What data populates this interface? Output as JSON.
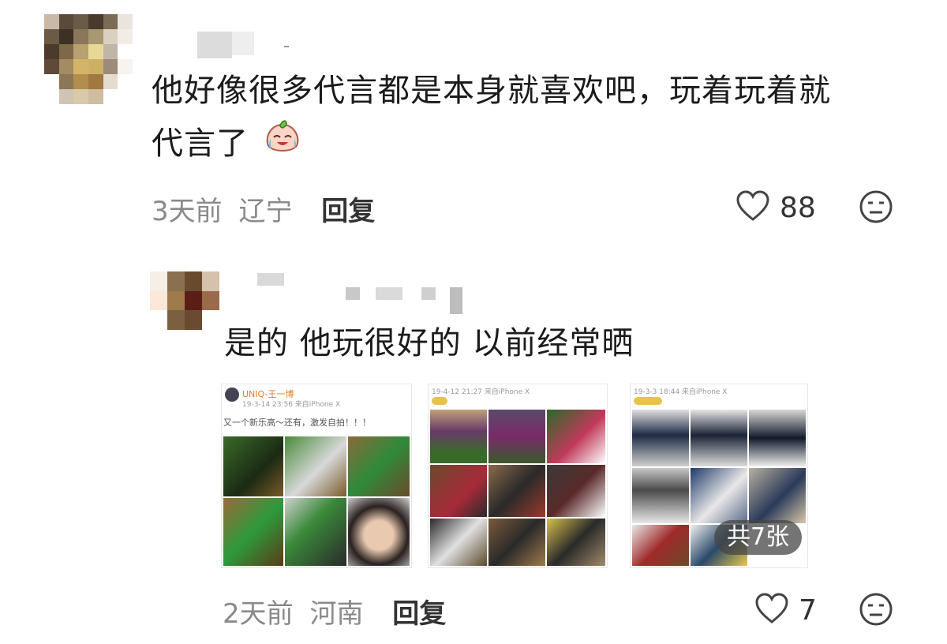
{
  "comment1": {
    "text_line1": "他好像很多代言都是本身就喜欢吧，玩着玩着就",
    "text_line2": "代言了",
    "time": "3天前",
    "location": "辽宁",
    "reply_label": "回复",
    "likes": "88"
  },
  "comment2": {
    "text": "是的 他玩很好的 以前经常晒",
    "time": "2天前",
    "location": "河南",
    "reply_label": "回复",
    "likes": "7",
    "images": [
      {
        "header_name": "UNIQ-王一博",
        "header_time": "19-3-14 23:56 来自iPhone X",
        "caption": "又一个新乐高～还有，激发自拍！！！"
      },
      {
        "header_time": "19-4-12 21:27 来自iPhone X"
      },
      {
        "header_time": "19-3-3 18:44 来自iPhone X",
        "count_badge": "共7张"
      }
    ]
  },
  "icons": {
    "like": "heart-outline-icon",
    "dislike": "neutral-face-icon",
    "emoji": "crying-laughing-peach-emoji"
  },
  "colors": {
    "meta_gray": "#8a8a8a",
    "reply_dark": "#333333"
  }
}
